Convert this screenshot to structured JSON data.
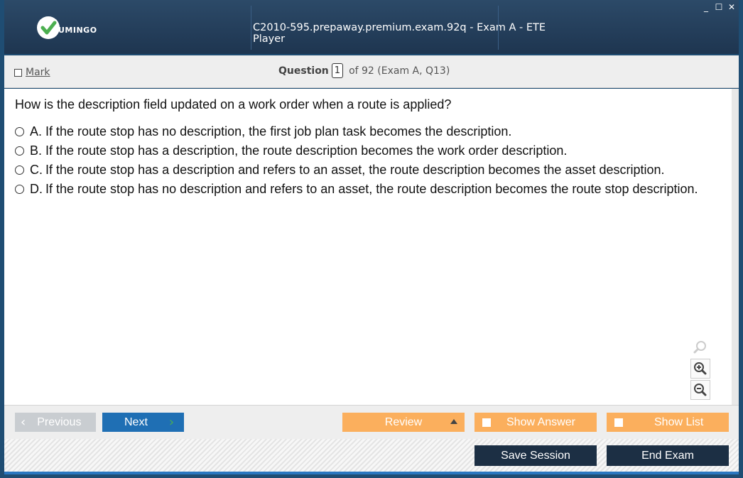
{
  "app": {
    "logo_text": "UMINGO",
    "window_title": "C2010-595.prepaway.premium.exam.92q - Exam A - ETE Player",
    "window_controls": {
      "minimize": "_",
      "maximize": "☐",
      "close": "✕"
    }
  },
  "header": {
    "mark_label": "Mark",
    "question_label": "Question",
    "question_number": "1",
    "question_of": "of 92 (Exam A, Q13)"
  },
  "question": {
    "text": "How is the description field updated on a work order when a route is applied?",
    "answers": [
      {
        "letter": "A.",
        "text": "If the route stop has no description, the first job plan task becomes the description."
      },
      {
        "letter": "B.",
        "text": "If the route stop has a description, the route description becomes the work order description."
      },
      {
        "letter": "C.",
        "text": "If the route stop has a description and refers to an asset, the route description becomes the asset description."
      },
      {
        "letter": "D.",
        "text": "If the route stop has no description and refers to an asset, the route description becomes the route stop description."
      }
    ]
  },
  "zoom": {
    "icons": [
      "zoom-reset-icon",
      "zoom-in-icon",
      "zoom-out-icon"
    ]
  },
  "nav": {
    "previous_label": "Previous",
    "next_label": "Next",
    "review_label": "Review",
    "show_answer_label": "Show Answer",
    "show_list_label": "Show List",
    "save_session_label": "Save Session",
    "end_exam_label": "End Exam"
  },
  "colors": {
    "titlebar": "#1e3550",
    "next_button": "#1f6fb4",
    "orange_button": "#fbaf5d",
    "dark_button": "#1c2f44",
    "logo_check": "#4caf50"
  }
}
